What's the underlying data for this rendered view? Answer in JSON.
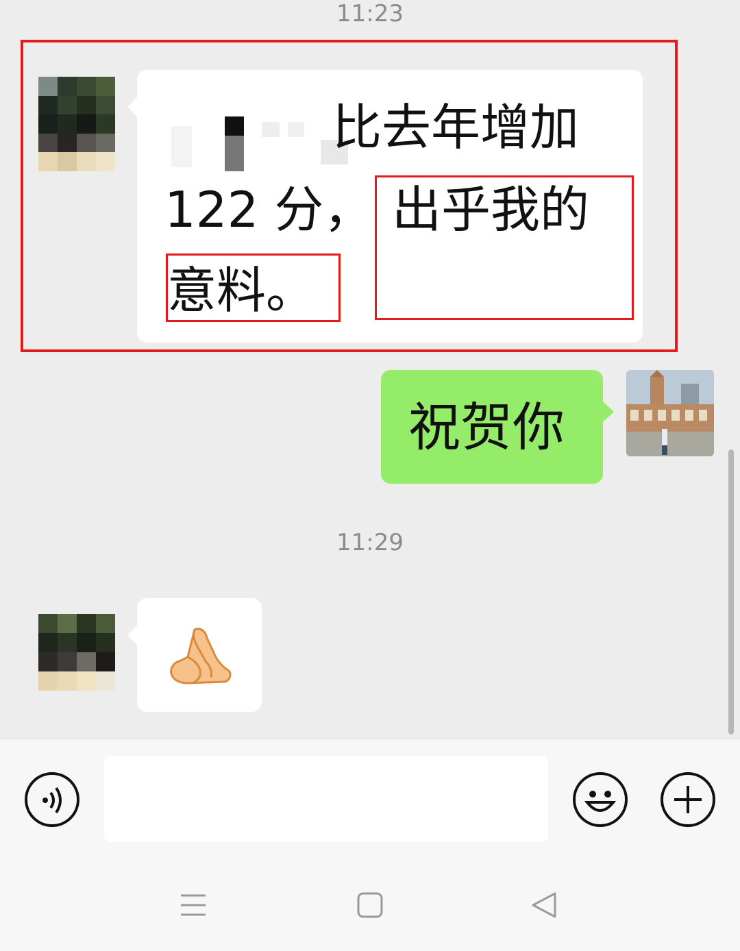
{
  "chat": {
    "timestamp_1": "11:23",
    "msg1": {
      "line1_tail": "比去年增加",
      "line2_a": "122 分，",
      "line2_b": "出乎我的",
      "line3": "意料。"
    },
    "msg2": {
      "text": "祝贺你"
    },
    "timestamp_2": "11:29",
    "msg3": {
      "emoji": "🙏"
    }
  },
  "input_bar": {
    "voice_icon": "voice-icon",
    "emoji_icon": "smiley-icon",
    "plus_icon": "plus-icon",
    "text_value": ""
  },
  "nav_bar": {
    "icons": [
      "menu-icon",
      "home-square-icon",
      "back-triangle-icon"
    ]
  },
  "colors": {
    "background": "#ededed",
    "outgoing_bubble": "#95ec69",
    "incoming_bubble": "#ffffff",
    "annotation_red": "#e31b1b"
  }
}
